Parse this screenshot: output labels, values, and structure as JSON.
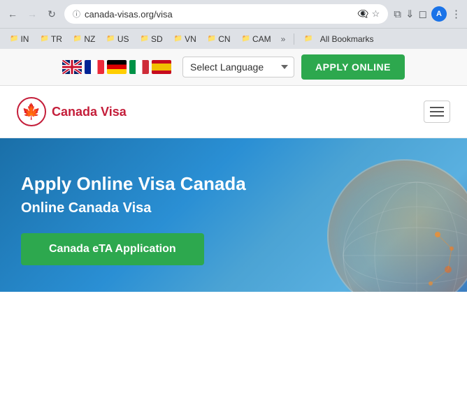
{
  "browser": {
    "url": "canada-visas.org/visa",
    "back_disabled": false,
    "forward_disabled": true,
    "avatar_initial": "A"
  },
  "bookmarks": {
    "items": [
      {
        "label": "IN",
        "id": "in"
      },
      {
        "label": "TR",
        "id": "tr"
      },
      {
        "label": "NZ",
        "id": "nz"
      },
      {
        "label": "US",
        "id": "us"
      },
      {
        "label": "SD",
        "id": "sd"
      },
      {
        "label": "VN",
        "id": "vn"
      },
      {
        "label": "CN",
        "id": "cn"
      },
      {
        "label": "CAM",
        "id": "cam"
      }
    ],
    "more_label": "»",
    "all_bookmarks_label": "All Bookmarks"
  },
  "top_strip": {
    "select_language_placeholder": "Select Language",
    "apply_button_label": "APPLY ONLINE",
    "language_options": [
      {
        "value": "en",
        "label": "English"
      },
      {
        "value": "fr",
        "label": "French"
      },
      {
        "value": "de",
        "label": "German"
      },
      {
        "value": "it",
        "label": "Italian"
      },
      {
        "value": "es",
        "label": "Spanish"
      }
    ]
  },
  "site_header": {
    "logo_text": "Canada Visa"
  },
  "hero": {
    "title": "Apply Online Visa Canada",
    "subtitle": "Online Canada Visa",
    "cta_button_label": "Canada eTA Application"
  }
}
